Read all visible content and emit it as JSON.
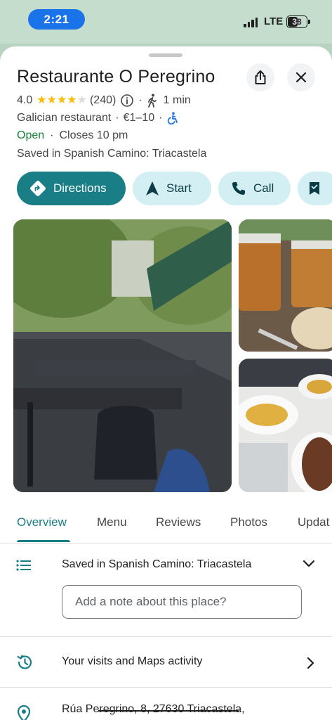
{
  "status_bar": {
    "time": "2:21",
    "network": "LTE",
    "battery": "38"
  },
  "place": {
    "name": "Restaurante O Peregrino",
    "rating": "4.0",
    "stars_filled": 4,
    "stars_total": 5,
    "review_count": "(240)",
    "walk_time": "1 min",
    "category": "Galician restaurant",
    "price": "€1–10",
    "open_status": "Open",
    "closes": "Closes 10 pm",
    "saved_in": "Saved in Spanish Camino: Triacastela"
  },
  "actions": {
    "directions": "Directions",
    "start": "Start",
    "call": "Call"
  },
  "tabs": [
    {
      "label": "Overview"
    },
    {
      "label": "Menu"
    },
    {
      "label": "Reviews"
    },
    {
      "label": "Photos"
    },
    {
      "label": "Updat"
    }
  ],
  "saved_list": {
    "label": "Saved in Spanish Camino: Triacastela",
    "note_placeholder": "Add a note about this place?"
  },
  "visits": {
    "label": "Your visits and Maps activity"
  },
  "address": {
    "text": "Rúa Peregrino, 8, 27630 Triacastela,"
  },
  "colors": {
    "accent": "#1a7e87",
    "chip_light": "#d3eff3",
    "open_green": "#188038",
    "star_yellow": "#fbbc04",
    "time_pill": "#1a73e8"
  }
}
